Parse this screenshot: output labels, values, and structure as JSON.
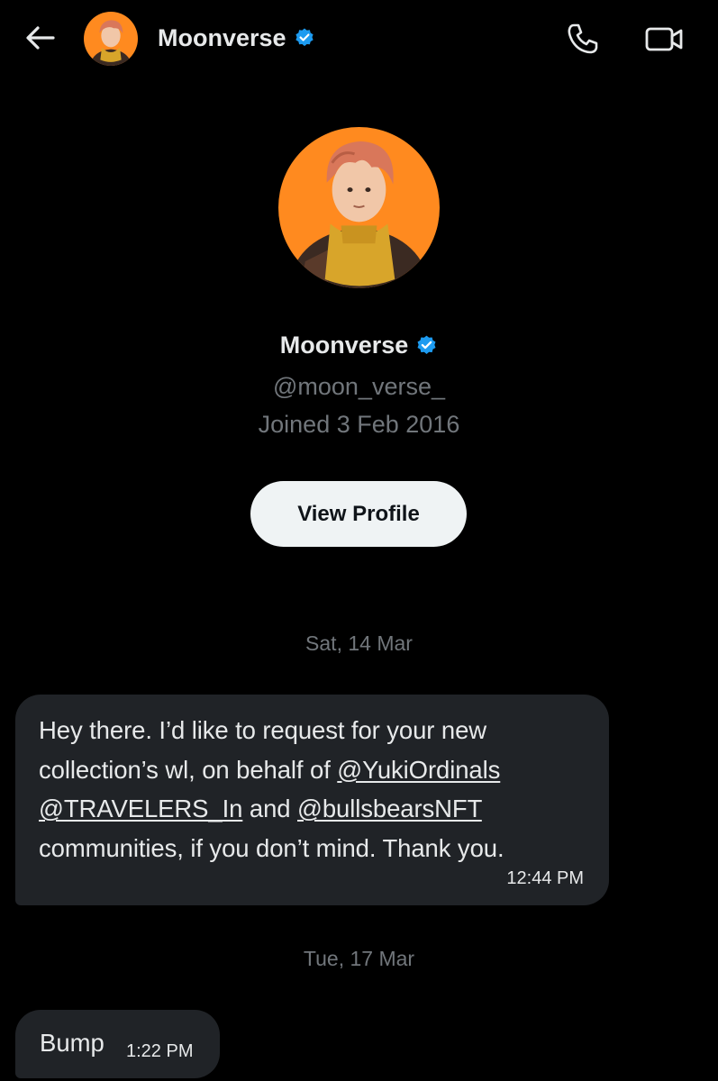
{
  "header": {
    "back_icon": "arrow-left-icon",
    "name": "Moonverse",
    "verified_icon": "verified-badge-icon",
    "call_icon": "phone-icon",
    "video_icon": "video-camera-icon"
  },
  "profile": {
    "name": "Moonverse",
    "handle": "@moon_verse_",
    "joined": "Joined 3 Feb 2016",
    "view_profile_label": "View Profile"
  },
  "messages": [
    {
      "date": "Sat, 14 Mar",
      "segments": [
        {
          "text": "Hey there. I’d like to request for your new collection’s wl, on behalf of ",
          "mention": false
        },
        {
          "text": "@YukiOrdinals",
          "mention": true
        },
        {
          "text": " ",
          "mention": false
        },
        {
          "text": "@TRAVELERS_In",
          "mention": true
        },
        {
          "text": " and ",
          "mention": false
        },
        {
          "text": "@bullsbearsNFT",
          "mention": true
        },
        {
          "text": " communities, if you don’t mind. Thank you.",
          "mention": false
        }
      ],
      "time": "12:44 PM"
    },
    {
      "date": "Tue, 17 Mar",
      "text": "Bump",
      "time": "1:22 PM"
    }
  ],
  "colors": {
    "background": "#000000",
    "bubble": "#202327",
    "muted_text": "#71767b",
    "verified": "#1d9bf0",
    "avatar_bg": "#ff8a1f"
  }
}
